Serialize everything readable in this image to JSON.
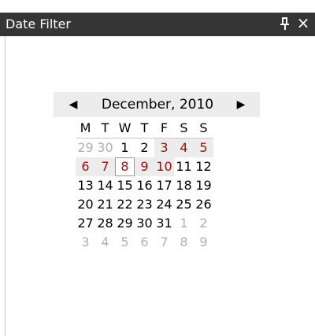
{
  "window": {
    "title": "Date Filter",
    "pin_icon": "pin-icon",
    "close_label": "×"
  },
  "calendar": {
    "prev_label": "◀",
    "next_label": "▶",
    "month_label": "December, 2010",
    "weekdays": [
      "M",
      "T",
      "W",
      "T",
      "F",
      "S",
      "S"
    ],
    "weeks": [
      [
        "29",
        "30",
        "1",
        "2",
        "3",
        "4",
        "5"
      ],
      [
        "6",
        "7",
        "8",
        "9",
        "10",
        "11",
        "12"
      ],
      [
        "13",
        "14",
        "15",
        "16",
        "17",
        "18",
        "19"
      ],
      [
        "20",
        "21",
        "22",
        "23",
        "24",
        "25",
        "26"
      ],
      [
        "27",
        "28",
        "29",
        "30",
        "31",
        "1",
        "2"
      ],
      [
        "3",
        "4",
        "5",
        "6",
        "7",
        "8",
        "9"
      ]
    ],
    "selected_day": "8",
    "colors": {
      "accent": "#9b1010",
      "muted": "#b0b0b0",
      "highlight": "#ececec",
      "titlebar": "#353535"
    }
  }
}
